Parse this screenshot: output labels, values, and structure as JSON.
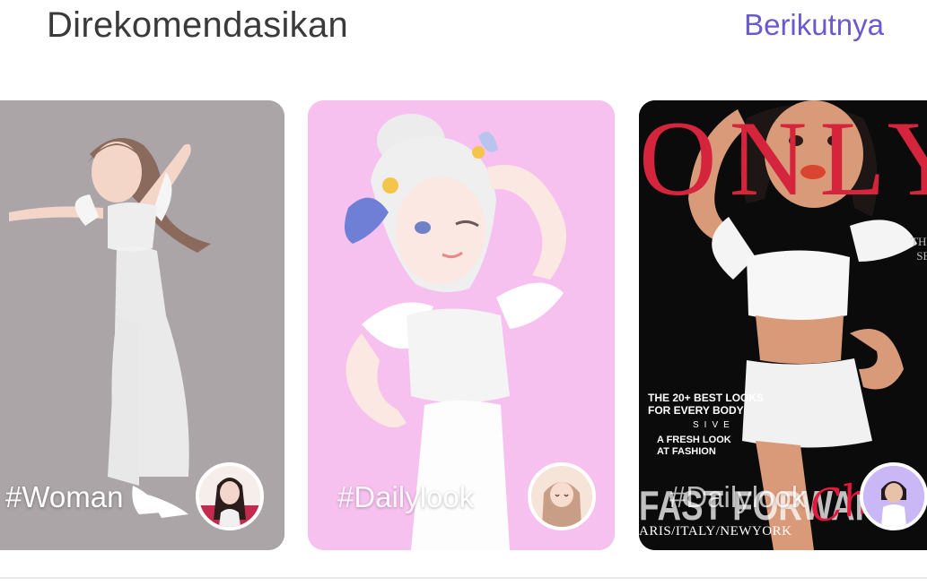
{
  "header": {
    "title": "Direkomendasikan",
    "next_label": "Berikutnya"
  },
  "cards": [
    {
      "hashtag": "#Woman",
      "background": "#aca5a7"
    },
    {
      "hashtag": "#Dailylook",
      "background": "#f6c1ef"
    },
    {
      "hashtag": "#Dailylook",
      "background": "#0b0b0b",
      "magazine": {
        "title": "ONLY",
        "side_text": "THE N\nSEAS",
        "headline": "THE 20+ BEST LOOKS\nFOR EVERY BODY",
        "exclusive": "SIVE",
        "fresh": "A FRESH LOOK\nAT FASHION",
        "fast_forward": "FAST FORWARD",
        "cities": "ARIS/ITALY/NEWYORK",
        "script": "Chic"
      }
    }
  ],
  "colors": {
    "title": "#3a3a3a",
    "accent": "#6a5acd",
    "magazine_red": "#d4253c"
  }
}
